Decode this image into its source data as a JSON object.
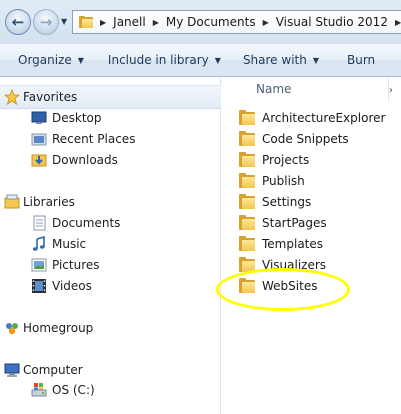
{
  "address": {
    "segments": [
      "Janell",
      "My Documents",
      "Visual Studio 2012"
    ]
  },
  "command_bar": {
    "organize": "Organize",
    "include_in_library": "Include in library",
    "share_with": "Share with",
    "burn": "Burn",
    "overflow": "N"
  },
  "nav_pane": {
    "favorites": {
      "label": "Favorites",
      "items": [
        "Desktop",
        "Recent Places",
        "Downloads"
      ]
    },
    "libraries": {
      "label": "Libraries",
      "items": [
        "Documents",
        "Music",
        "Pictures",
        "Videos"
      ]
    },
    "homegroup": {
      "label": "Homegroup"
    },
    "computer": {
      "label": "Computer",
      "items": [
        "OS (C:)"
      ]
    }
  },
  "file_pane": {
    "column_name": "Name",
    "folders": [
      "ArchitectureExplorer",
      "Code Snippets",
      "Projects",
      "Publish",
      "Settings",
      "StartPages",
      "Templates",
      "Visualizers",
      "WebSites"
    ]
  },
  "colors": {
    "highlight": "#ffff00",
    "folder": "#f3c64e",
    "command_text": "#1e395b"
  },
  "icons": {
    "back": "back-arrow-icon",
    "forward": "forward-arrow-icon",
    "folder": "folder-icon",
    "star": "favorites-star-icon"
  }
}
